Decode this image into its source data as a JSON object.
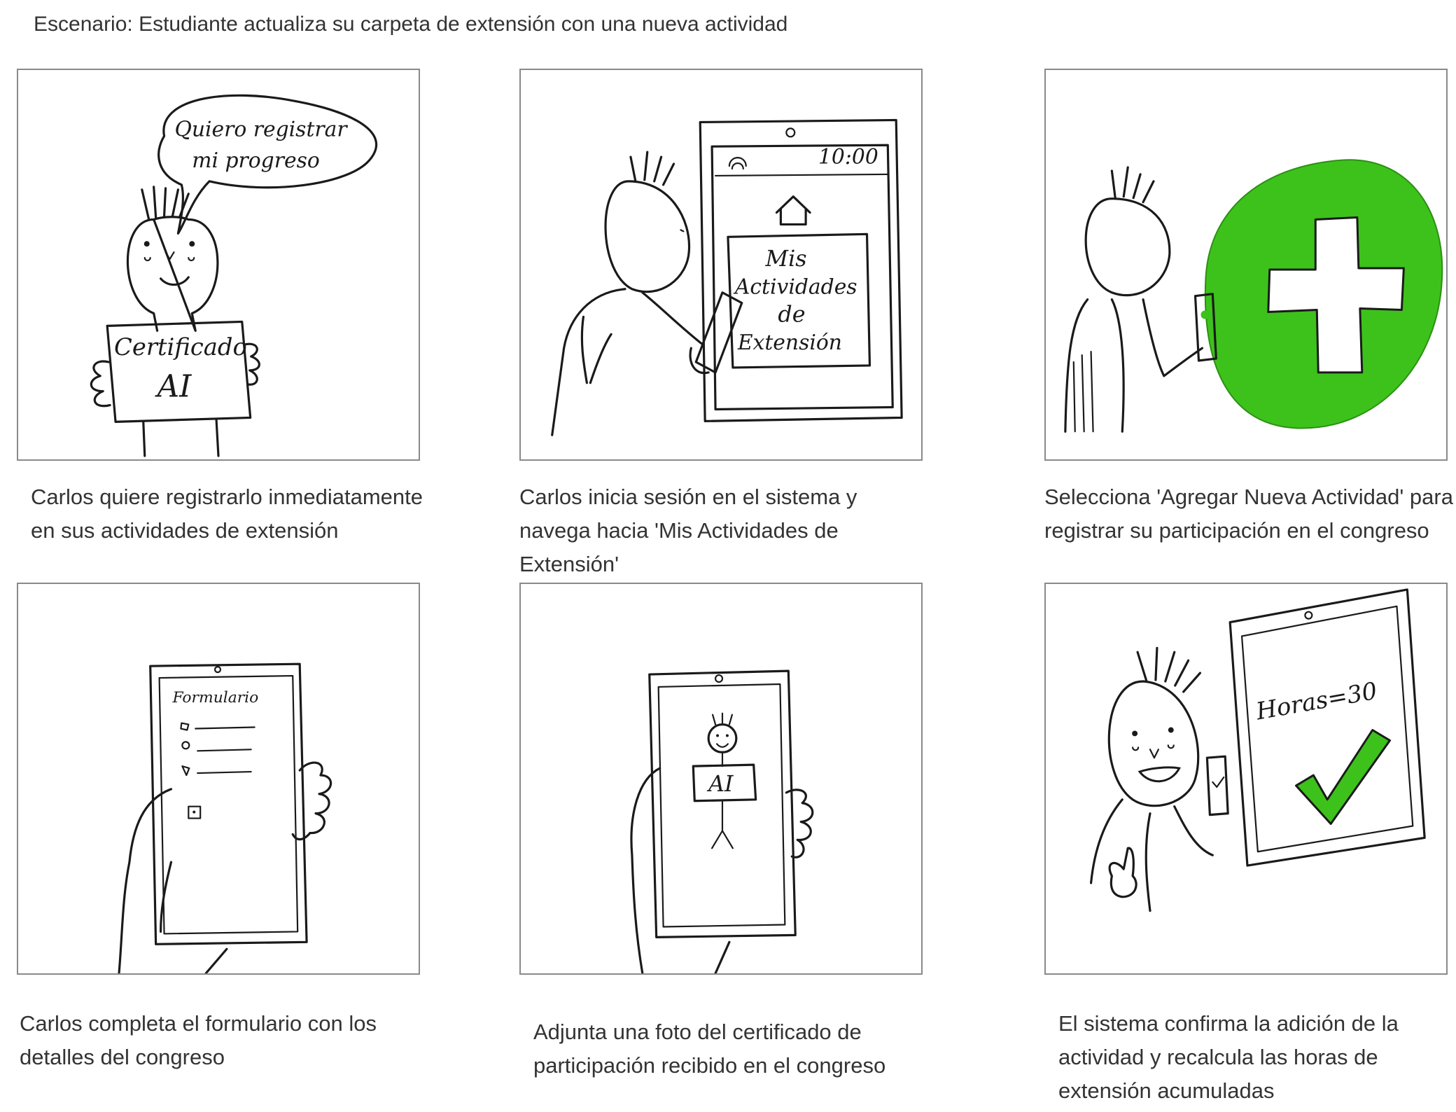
{
  "title": "Escenario: Estudiante actualiza su carpeta de extensión con una nueva actividad",
  "colors": {
    "accent_green": "#3dc21b",
    "ink": "#1a1a1a",
    "frame": "#8a8a8a",
    "text": "#333333"
  },
  "panels": [
    {
      "caption": "Carlos quiere registrarlo inmediatamente en sus actividades de extensión",
      "speech_line1": "Quiero registrar",
      "speech_line2": "mi progreso",
      "sign_line1": "Certificado",
      "sign_line2": "AI"
    },
    {
      "caption": "Carlos inicia sesión en el sistema y navega hacia 'Mis Actividades de Extensión'",
      "phone_time": "10:00",
      "screen_line1": "Mis",
      "screen_line2": "Actividades",
      "screen_line3": "de",
      "screen_line4": "Extensión"
    },
    {
      "caption": "Selecciona 'Agregar Nueva Actividad' para registrar su participación en el congreso",
      "icon": "plus-icon"
    },
    {
      "caption": "Carlos completa el formulario con los detalles del congreso",
      "form_title": "Formulario"
    },
    {
      "caption": "Adjunta una foto del certificado de participación recibido en el congreso",
      "photo_sign": "AI"
    },
    {
      "caption": "El sistema confirma la adición de la actividad y recalcula las horas de extensión acumuladas",
      "hours_label": "Horas=30",
      "icon": "check-icon"
    }
  ]
}
